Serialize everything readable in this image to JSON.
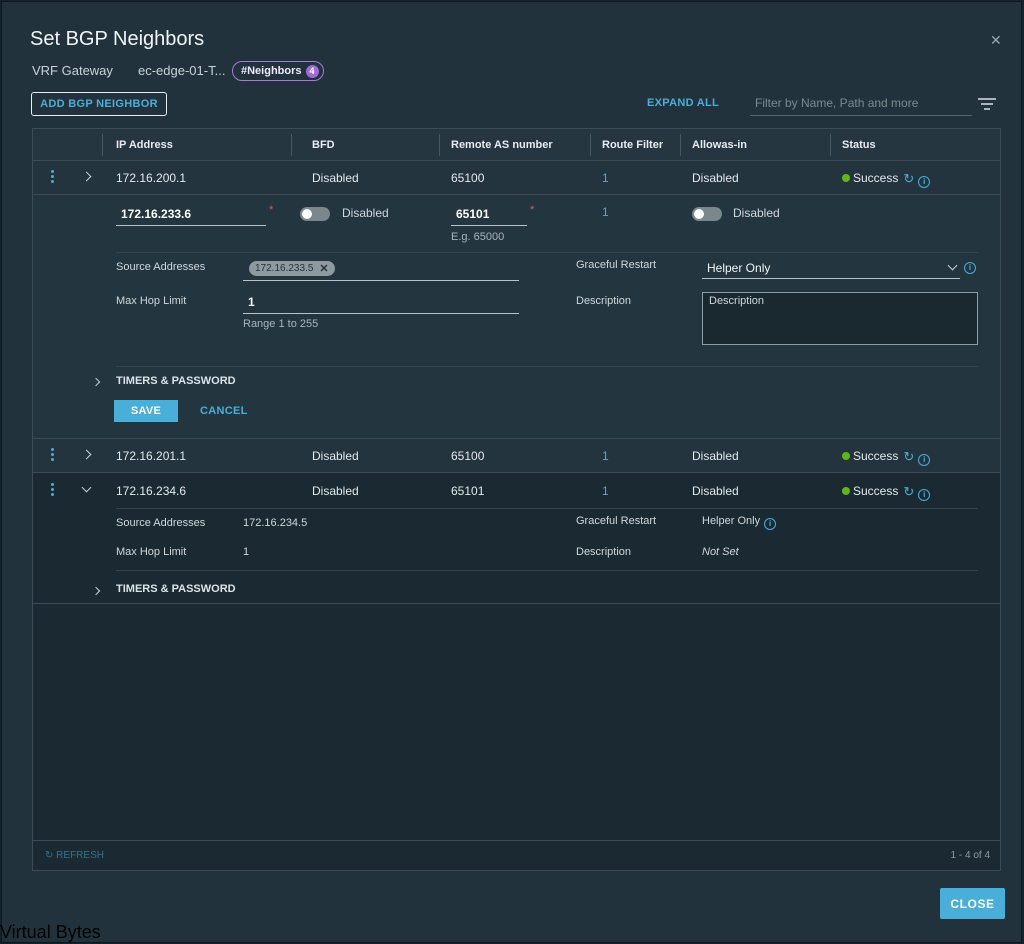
{
  "modal": {
    "title": "Set BGP Neighbors",
    "vrf_label": "VRF Gateway",
    "vrf_value": "ec-edge-01-T...",
    "tag_label": "#Neighbors",
    "tag_count": "4"
  },
  "toolbar": {
    "add_label": "ADD BGP NEIGHBOR",
    "expand_label": "EXPAND ALL",
    "filter_placeholder": "Filter by Name, Path and more"
  },
  "columns": [
    "IP Address",
    "BFD",
    "Remote AS number",
    "Route Filter",
    "Allowas-in",
    "Status"
  ],
  "rows": [
    {
      "ip": "172.16.200.1",
      "bfd": "Disabled",
      "remote_as": "65100",
      "route_filter": "1",
      "allowas": "Disabled",
      "status": "Success"
    },
    {
      "ip": "172.16.201.1",
      "bfd": "Disabled",
      "remote_as": "65100",
      "route_filter": "1",
      "allowas": "Disabled",
      "status": "Success"
    },
    {
      "ip": "172.16.234.6",
      "bfd": "Disabled",
      "remote_as": "65101",
      "route_filter": "1",
      "allowas": "Disabled",
      "status": "Success"
    }
  ],
  "edit": {
    "ip_value": "172.16.233.6",
    "bfd_label": "Disabled",
    "remote_as_value": "65101",
    "remote_as_hint": "E.g. 65000",
    "route_filter": "1",
    "allowas_label": "Disabled",
    "source_addresses_label": "Source Addresses",
    "source_chip": "172.16.233.5",
    "max_hop_label": "Max Hop Limit",
    "max_hop_value": "1",
    "max_hop_hint": "Range 1 to 255",
    "graceful_label": "Graceful Restart",
    "graceful_value": "Helper Only",
    "description_label": "Description",
    "description_placeholder": "Description",
    "timers_label": "TIMERS & PASSWORD",
    "save_label": "SAVE",
    "cancel_label": "CANCEL"
  },
  "detail": {
    "source_addresses_label": "Source Addresses",
    "source_addresses_value": "172.16.234.5",
    "max_hop_label": "Max Hop Limit",
    "max_hop_value": "1",
    "graceful_label": "Graceful Restart",
    "graceful_value": "Helper Only",
    "description_label": "Description",
    "description_value": "Not Set",
    "timers_label": "TIMERS & PASSWORD"
  },
  "footer": {
    "refresh_label": "REFRESH",
    "paging": "1 - 4 of 4"
  },
  "close_label": "CLOSE",
  "watermark": "Virtual Bytes",
  "colors": {
    "accent": "#49afd9",
    "success": "#5eb715",
    "required": "#e25d4a",
    "tag": "#a97bd9"
  }
}
